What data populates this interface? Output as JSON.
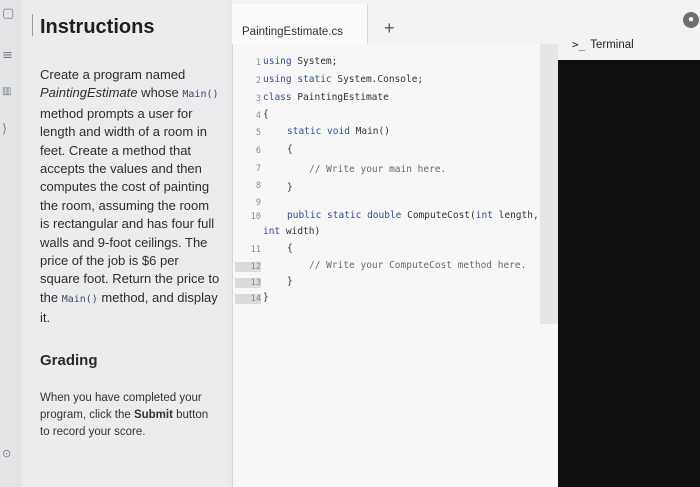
{
  "instructions": {
    "title": "Instructions",
    "p_create": "Create a program named",
    "p_name": "PaintingEstimate",
    "p_whose": " whose",
    "p_main": "Main()",
    "p_line": " method prompts a user for length and width of a room in feet. Create a method that accepts the values and then computes the cost of painting the room, assuming the room is rectangular and has four full walls and 9-foot ceilings. The price of the job is $6 per square foot. Return the price to the ",
    "p_main2": "Main()",
    "p_end": " method, and display it.",
    "grading_title": "Grading",
    "grading_before": "When you have completed your program, click the ",
    "grading_submit": "Submit",
    "grading_after": " button to record your score."
  },
  "editor": {
    "tab_label": "PaintingEstimate.cs",
    "add_tab": "+",
    "line_numbers": [
      "1",
      "2",
      "3",
      "4",
      "5",
      "6",
      "7",
      "8",
      "9",
      "10",
      "11",
      "12",
      "13",
      "14"
    ],
    "code": {
      "l1_kw": "using",
      "l1_rest": " System;",
      "l2_kw": "using static",
      "l2_rest": " System.Console;",
      "l3_kw": "class",
      "l3_rest": " PaintingEstimate",
      "l4": "{",
      "l5_kw": "static void",
      "l5_rest": " Main()",
      "l6": "{",
      "l7": "// Write your main here.",
      "l8": "}",
      "l10_kw": "public static double",
      "l10_rest": " ComputeCost(",
      "l10_int": "int",
      "l10_tail": " length,",
      "l10b_int": "int",
      "l10b_tail": " width)",
      "l11": "{",
      "l12": "// Write your ComputeCost method here.",
      "l13": "}",
      "l14": "}"
    }
  },
  "terminal": {
    "prompt": ">_",
    "label": "Terminal"
  },
  "rail": {
    "icons": [
      "file-icon",
      "list-icon",
      "chart-icon",
      "code-icon",
      "help-icon"
    ]
  },
  "colors": {
    "terminal_bg": "#0f0f10",
    "keyword": "#2f4f8f"
  }
}
